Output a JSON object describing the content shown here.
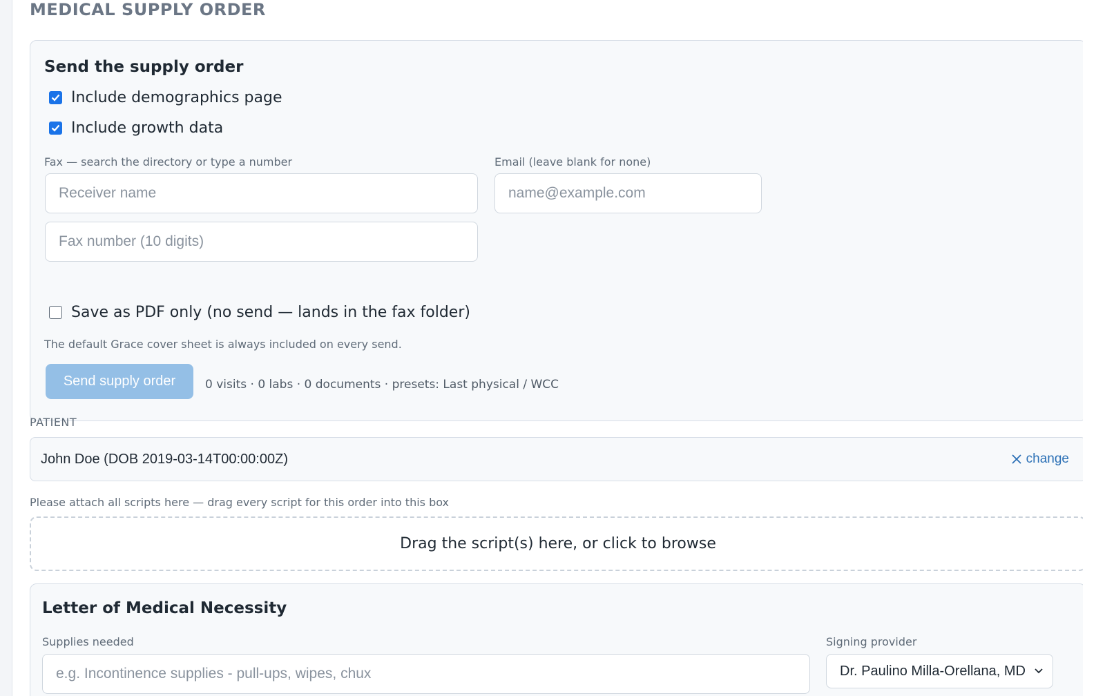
{
  "page": {
    "title": "MEDICAL SUPPLY ORDER"
  },
  "send_section": {
    "title": "Send the supply order",
    "include_demographics": {
      "label": "Include demographics page",
      "checked": true
    },
    "include_growth": {
      "label": "Include growth data",
      "checked": true
    },
    "fax_label": "Fax — search the directory or type a number",
    "receiver_placeholder": "Receiver name",
    "fax_number_placeholder": "Fax number (10 digits)",
    "email_label": "Email (leave blank for none)",
    "email_placeholder": "name@example.com",
    "save_pdf_only": {
      "label": "Save as PDF only (no send — lands in the fax folder)",
      "checked": false
    },
    "cover_note": "The default Grace cover sheet is always included on every send.",
    "send_button": "Send supply order",
    "summary": "0 visits · 0 labs · 0 documents · presets: Last physical / WCC"
  },
  "patient": {
    "label": "PATIENT",
    "name": "John Doe (DOB 2019-03-14T00:00:00Z)",
    "change_label": "change"
  },
  "attach": {
    "label": "Please attach all scripts here — drag every script for this order into this box",
    "dropzone_text": "Drag the script(s) here, or click to browse"
  },
  "lmn": {
    "title": "Letter of Medical Necessity",
    "supplies_label": "Supplies needed",
    "supplies_placeholder": "e.g. Incontinence supplies - pull-ups, wipes, chux",
    "provider_label": "Signing provider",
    "provider_value": "Dr. Paulino Milla-Orellana, MD"
  },
  "colors": {
    "accent": "#1a73e8",
    "button_disabled": "#94bfe6",
    "link": "#2a6fb5"
  }
}
